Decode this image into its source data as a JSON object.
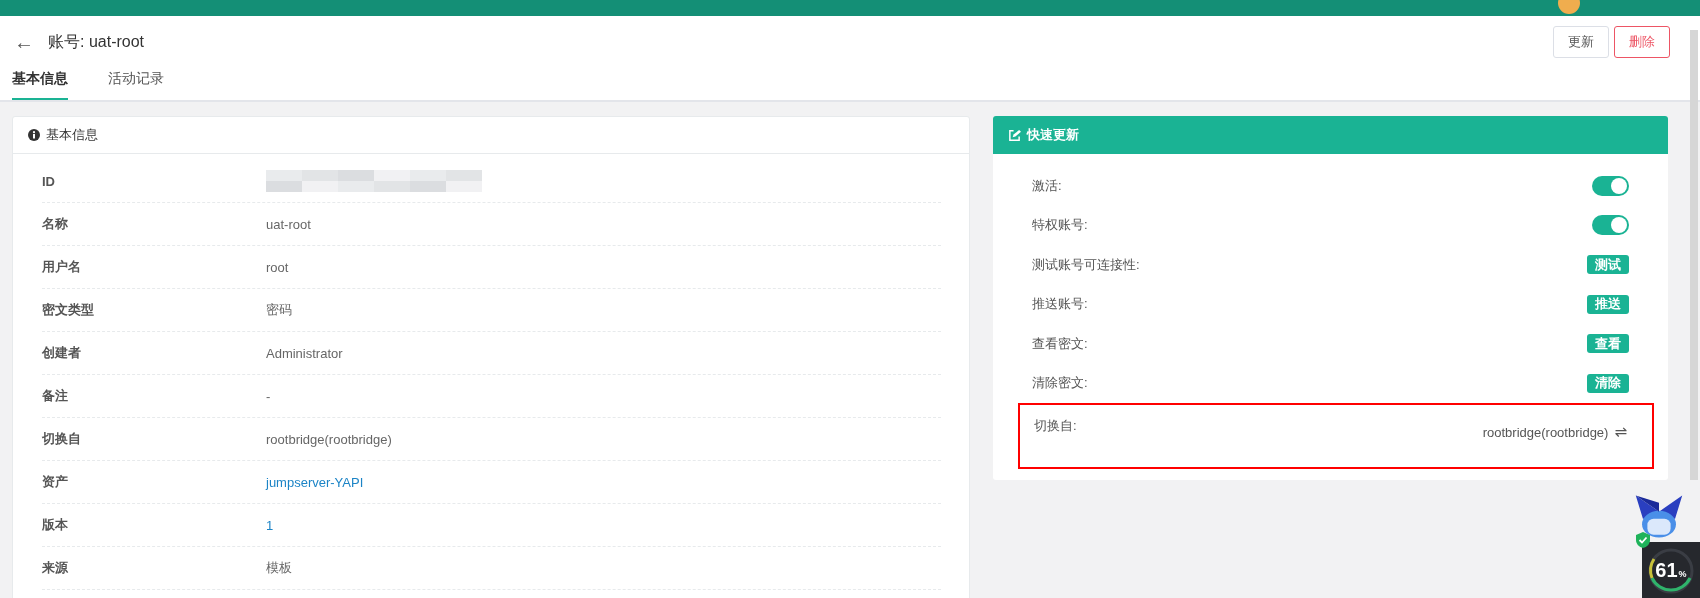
{
  "header": {
    "back": "←",
    "title": "账号: uat-root",
    "buttons": [
      {
        "label": "更新",
        "kind": "default"
      },
      {
        "label": "删除",
        "kind": "danger"
      }
    ]
  },
  "tabs": [
    {
      "label": "基本信息",
      "selected": true
    },
    {
      "label": "活动记录",
      "selected": false
    }
  ],
  "info_panel": {
    "title": "基本信息",
    "rows": [
      {
        "label": "ID",
        "kind": "redacted"
      },
      {
        "label": "名称",
        "value": "uat-root",
        "kind": "text"
      },
      {
        "label": "用户名",
        "value": "root",
        "kind": "text"
      },
      {
        "label": "密文类型",
        "value": "密码",
        "kind": "text"
      },
      {
        "label": "创建者",
        "value": "Administrator",
        "kind": "text"
      },
      {
        "label": "备注",
        "value": "-",
        "kind": "text"
      },
      {
        "label": "切换自",
        "value": "rootbridge(rootbridge)",
        "kind": "text"
      },
      {
        "label": "资产",
        "value": "jumpserver-YAPI",
        "kind": "link"
      },
      {
        "label": "版本",
        "value": "1",
        "kind": "link"
      },
      {
        "label": "来源",
        "value": "模板",
        "kind": "text"
      }
    ]
  },
  "quick_panel": {
    "title": "快速更新",
    "rows": [
      {
        "label": "激活:",
        "kind": "toggle",
        "on": true
      },
      {
        "label": "特权账号:",
        "kind": "toggle",
        "on": true
      },
      {
        "label": "测试账号可连接性:",
        "kind": "button",
        "button": "测试"
      },
      {
        "label": "推送账号:",
        "kind": "button",
        "button": "推送"
      },
      {
        "label": "查看密文:",
        "kind": "button",
        "button": "查看"
      },
      {
        "label": "清除密文:",
        "kind": "button",
        "button": "清除"
      },
      {
        "label": "切换自:",
        "kind": "switch",
        "value": "rootbridge(rootbridge)",
        "icon": "⇌",
        "highlighted": true
      }
    ]
  },
  "widget": {
    "value": "61",
    "unit": "%"
  }
}
